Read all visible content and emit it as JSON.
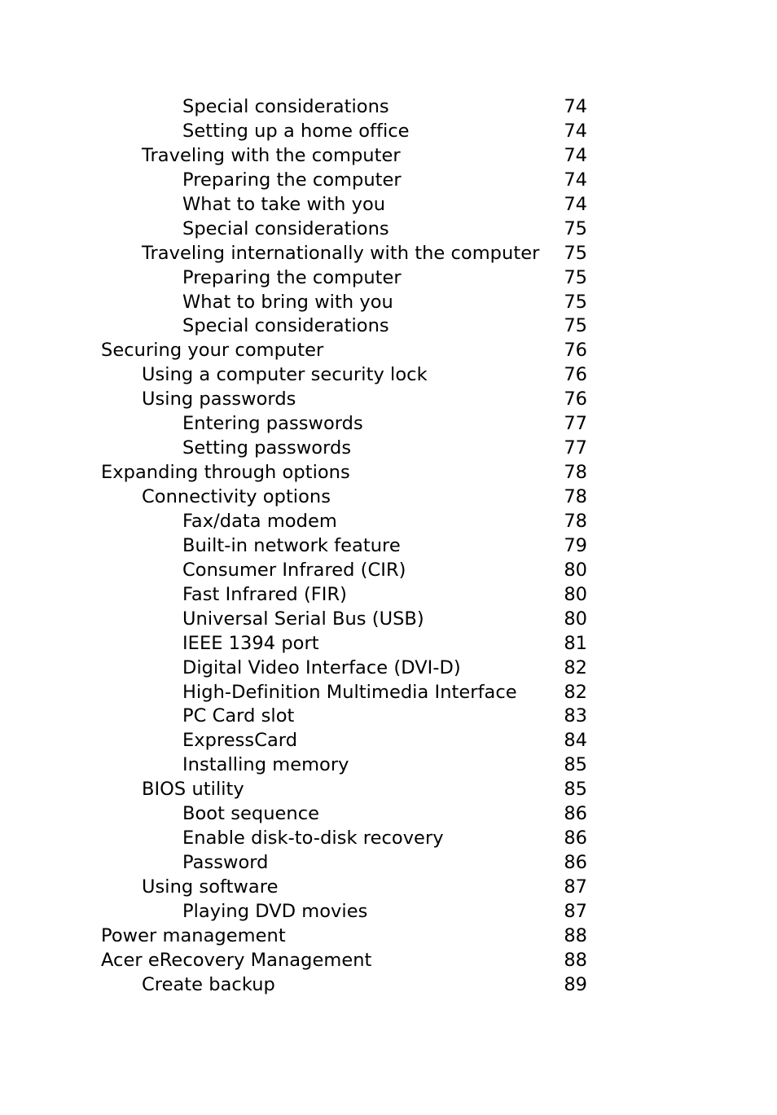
{
  "document": {
    "type": "table-of-contents",
    "entries": [
      {
        "title": "Special considerations",
        "page": "74",
        "level": 2
      },
      {
        "title": "Setting up a home office",
        "page": "74",
        "level": 2
      },
      {
        "title": "Traveling with the computer",
        "page": "74",
        "level": 1
      },
      {
        "title": "Preparing the computer",
        "page": "74",
        "level": 2
      },
      {
        "title": "What to take with you",
        "page": "74",
        "level": 2
      },
      {
        "title": "Special considerations",
        "page": "75",
        "level": 2
      },
      {
        "title": "Traveling internationally with the computer",
        "page": "75",
        "level": 1
      },
      {
        "title": "Preparing the computer",
        "page": "75",
        "level": 2
      },
      {
        "title": "What to bring with you",
        "page": "75",
        "level": 2
      },
      {
        "title": "Special considerations",
        "page": "75",
        "level": 2
      },
      {
        "title": "Securing your computer",
        "page": "76",
        "level": 0
      },
      {
        "title": "Using a computer security lock",
        "page": "76",
        "level": 1
      },
      {
        "title": "Using passwords",
        "page": "76",
        "level": 1
      },
      {
        "title": "Entering passwords",
        "page": "77",
        "level": 2
      },
      {
        "title": "Setting passwords",
        "page": "77",
        "level": 2
      },
      {
        "title": "Expanding through options",
        "page": "78",
        "level": 0
      },
      {
        "title": "Connectivity options",
        "page": "78",
        "level": 1
      },
      {
        "title": "Fax/data modem",
        "page": "78",
        "level": 2
      },
      {
        "title": "Built-in network feature",
        "page": "79",
        "level": 2
      },
      {
        "title": "Consumer Infrared (CIR)",
        "page": "80",
        "level": 2
      },
      {
        "title": "Fast Infrared (FIR)",
        "page": "80",
        "level": 2
      },
      {
        "title": "Universal Serial Bus (USB)",
        "page": "80",
        "level": 2
      },
      {
        "title": "IEEE 1394 port",
        "page": "81",
        "level": 2
      },
      {
        "title": "Digital Video Interface (DVI-D)",
        "page": "82",
        "level": 2
      },
      {
        "title": "High-Definition Multimedia Interface",
        "page": "82",
        "level": 2
      },
      {
        "title": "PC Card slot",
        "page": "83",
        "level": 2
      },
      {
        "title": "ExpressCard",
        "page": "84",
        "level": 2
      },
      {
        "title": "Installing memory",
        "page": "85",
        "level": 2
      },
      {
        "title": "BIOS utility",
        "page": "85",
        "level": 1
      },
      {
        "title": "Boot sequence",
        "page": "86",
        "level": 2
      },
      {
        "title": "Enable disk-to-disk recovery",
        "page": "86",
        "level": 2
      },
      {
        "title": "Password",
        "page": "86",
        "level": 2
      },
      {
        "title": "Using software",
        "page": "87",
        "level": 1
      },
      {
        "title": "Playing DVD movies",
        "page": "87",
        "level": 2
      },
      {
        "title": "Power management",
        "page": "88",
        "level": 0
      },
      {
        "title": "Acer eRecovery Management",
        "page": "88",
        "level": 0
      },
      {
        "title": "Create backup",
        "page": "89",
        "level": 1
      }
    ]
  }
}
